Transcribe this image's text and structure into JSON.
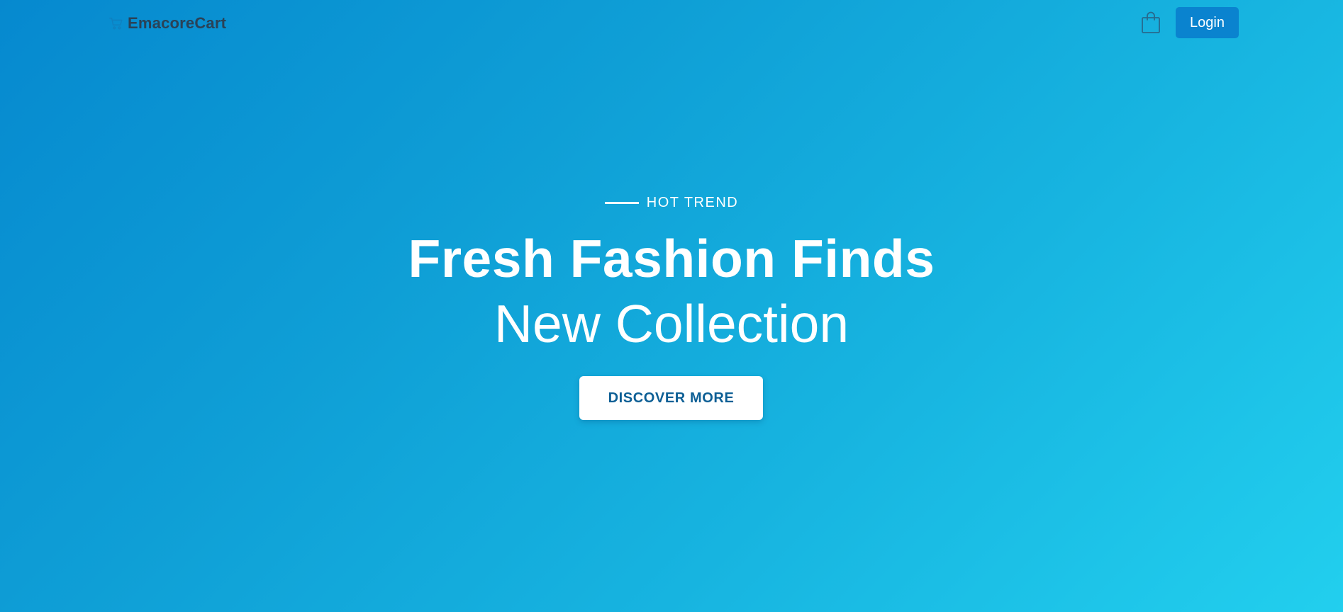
{
  "header": {
    "brand_name": "EmacoreCart",
    "brand_icon": "cart-logo-icon",
    "cart_icon": "shopping-bag-icon",
    "login_label": "Login"
  },
  "hero": {
    "eyebrow": "HOT TREND",
    "title": "Fresh Fashion Finds",
    "subtitle": "New Collection",
    "cta_label": "DISCOVER MORE"
  },
  "colors": {
    "gradient_start": "#0689cf",
    "gradient_end": "#22cfee",
    "login_button": "#0a83cf",
    "brand_text": "#2a4257",
    "cta_text": "#0d5f95"
  }
}
